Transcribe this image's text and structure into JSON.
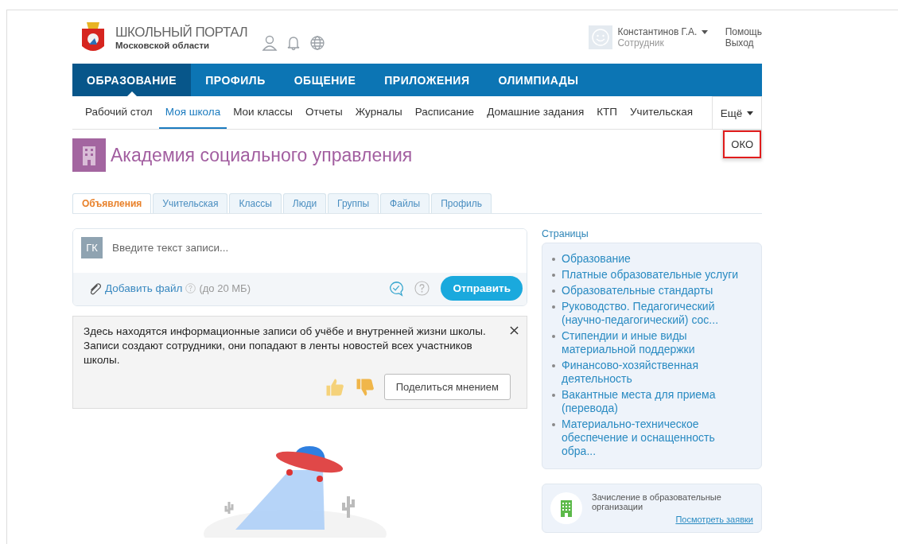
{
  "header": {
    "portal_title": "ШКОЛЬНЫЙ ПОРТАЛ",
    "region": "Московской области",
    "user_name": "Константинов Г.А.",
    "user_role": "Сотрудник",
    "links": [
      "Помощь",
      "Выход"
    ]
  },
  "main_nav": [
    {
      "label": "ОБРАЗОВАНИЕ",
      "selected": true
    },
    {
      "label": "ПРОФИЛЬ",
      "selected": false
    },
    {
      "label": "ОБЩЕНИЕ",
      "selected": false
    },
    {
      "label": "ПРИЛОЖЕНИЯ",
      "selected": false
    },
    {
      "label": "ОЛИМПИАДЫ",
      "selected": false
    }
  ],
  "sub_nav": [
    {
      "label": "Рабочий стол",
      "selected": false
    },
    {
      "label": "Моя школа",
      "selected": true
    },
    {
      "label": "Мои классы",
      "selected": false
    },
    {
      "label": "Отчеты",
      "selected": false
    },
    {
      "label": "Журналы",
      "selected": false
    },
    {
      "label": "Расписание",
      "selected": false
    },
    {
      "label": "Домашние задания",
      "selected": false
    },
    {
      "label": "КТП",
      "selected": false
    },
    {
      "label": "Учительская",
      "selected": false
    }
  ],
  "more_menu": {
    "label": "Ещё",
    "items": [
      {
        "label": "ОКО",
        "highlighted": true
      }
    ]
  },
  "school": {
    "name": "Академия социального управления"
  },
  "tabs": [
    {
      "label": "Объявления",
      "selected": true
    },
    {
      "label": "Учительская",
      "selected": false
    },
    {
      "label": "Классы",
      "selected": false
    },
    {
      "label": "Люди",
      "selected": false
    },
    {
      "label": "Группы",
      "selected": false
    },
    {
      "label": "Файлы",
      "selected": false
    },
    {
      "label": "Профиль",
      "selected": false
    }
  ],
  "composer": {
    "avatar": "ГК",
    "placeholder": "Введите текст записи...",
    "attach": "Добавить файл",
    "limit": "(до 20 МБ)",
    "send": "Отправить"
  },
  "info": {
    "text": "Здесь находятся информационные записи об учёбе и внутренней жизни школы. Записи создают сотрудники, они попадают в ленты новостей всех участников школы.",
    "share": "Поделиться мнением"
  },
  "pages": {
    "title": "Страницы",
    "items": [
      "Образование",
      "Платные образовательные услуги",
      "Образовательные стандарты",
      "Руководство. Педагогический (научно-педагогический) сос...",
      "Стипендии и иные виды материальной поддержки",
      "Финансово-хозяйственная деятельность",
      "Вакантные места для приема (перевода)",
      "Материально-техническое обеспечение и оснащенность обра..."
    ]
  },
  "enrollment": {
    "text": "Зачисление в образовательные организации",
    "link": "Посмотреть заявки"
  }
}
